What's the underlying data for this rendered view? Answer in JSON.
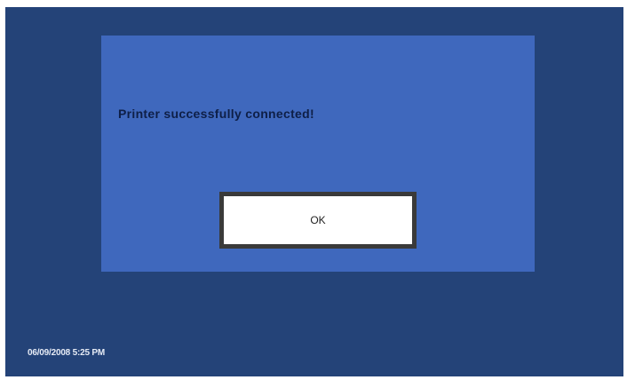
{
  "dialog": {
    "message": "Printer successfully connected!",
    "ok_label": "OK"
  },
  "status": {
    "timestamp": "06/09/2008 5:25 PM"
  },
  "colors": {
    "screen_background": "#244378",
    "dialog_background": "#3f68bd",
    "button_background": "#ffffff",
    "button_border": "#3a3a3a"
  }
}
